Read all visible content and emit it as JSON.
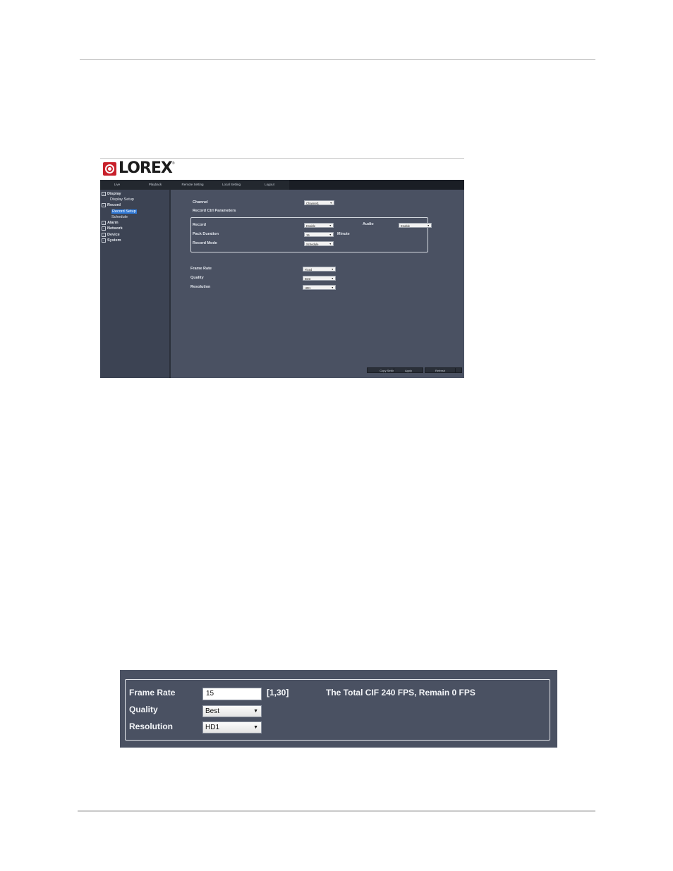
{
  "screenshot1": {
    "logo_text": "LOREX",
    "logo_reg": "®",
    "nav_tabs": [
      "Live",
      "Playback",
      "Remote Setting",
      "Local Setting",
      "Logout"
    ],
    "tree": [
      {
        "label": "Display",
        "expander": "+"
      },
      {
        "label": "Display Setup"
      },
      {
        "label": "Record",
        "expander": "+"
      },
      {
        "label": "Record Setup",
        "selected": true
      },
      {
        "label": "Schedule"
      },
      {
        "label": "Alarm",
        "expander": "+"
      },
      {
        "label": "Network",
        "expander": "+"
      },
      {
        "label": "Device",
        "expander": "+"
      },
      {
        "label": "System",
        "expander": "+"
      }
    ],
    "channel_label": "Channel",
    "channel_value": "Channel1",
    "group_title": "Record Ctrl Parameters",
    "record_label": "Record",
    "record_value": "Enable",
    "audio_label": "Audio",
    "audio_value": "Enable",
    "pack_label": "Pack Duration",
    "pack_value": "15",
    "pack_unit": "Minute",
    "mode_label": "Record Mode",
    "mode_value": "Schedule",
    "frame_rate_label": "Frame Rate",
    "frame_rate_value": "Fixed",
    "quality_label": "Quality",
    "quality_value": "Best",
    "resolution_label": "Resolution",
    "resolution_value": "HD1",
    "buttons": {
      "copy": "Copy Settings To...",
      "default": "Default",
      "apply": "Apply",
      "refresh": "Refresh"
    }
  },
  "screenshot2": {
    "frame_rate_label": "Frame Rate",
    "frame_rate_value": "15",
    "range": "[1,30]",
    "total_text": "The Total CIF 240 FPS, Remain 0 FPS",
    "quality_label": "Quality",
    "quality_value": "Best",
    "resolution_label": "Resolution",
    "resolution_value": "HD1"
  }
}
